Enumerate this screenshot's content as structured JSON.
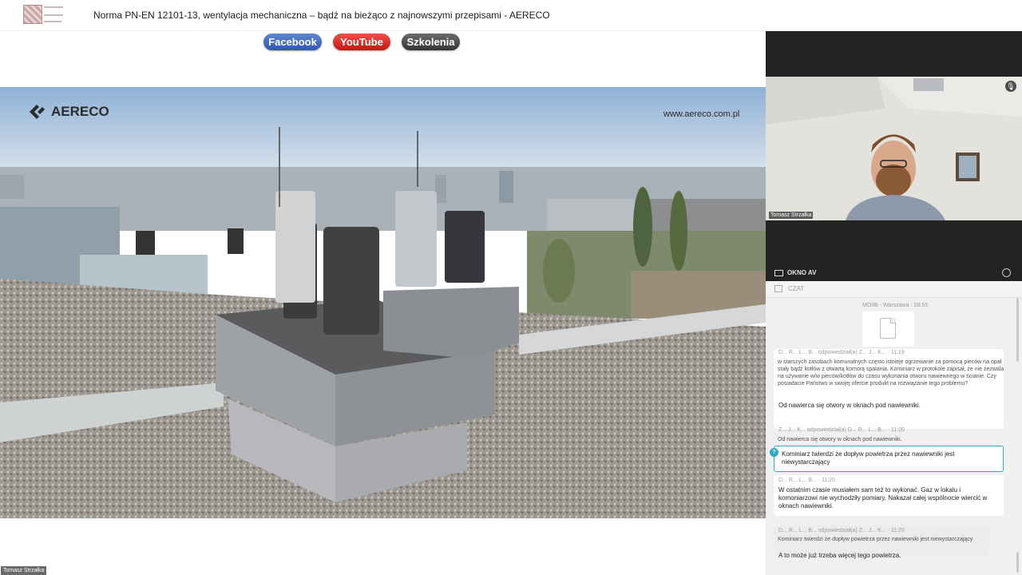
{
  "header": {
    "title": "Norma PN-EN 12101-13, wentylacja mechaniczna – bądź na bieżąco z najnowszymi przepisami - AERECO"
  },
  "social": {
    "facebook": "Facebook",
    "youtube": "YouTube",
    "szkolenia": "Szkolenia"
  },
  "slide": {
    "brand": "AERECO",
    "url": "www.aereco.com.pl"
  },
  "presenter_tag": "Tomasz Strzałka",
  "video_panel": {
    "camera_name": "Tomasz Strzałka",
    "av_label": "OKNO AV"
  },
  "chat": {
    "header": "CZAT",
    "messages": [
      {
        "meta": "MOIIB - Warszawa · 09:55",
        "type": "file"
      },
      {
        "meta": "D... R... L... B... odpowiedział(a) Z... J... K... · 11:19",
        "quote": "w starszych zasobach komunalnych często istnieje ogrzewanie za pomocą pieców na opał stały bądź kotłów z otwartą komorą spalania. Kominiarz w protokole zapisał, że nie zezwala na używanie w/w pieców/kotłów do czasu wykonania otworu nawiewnego w ścianie. Czy posiadacie Państwo w swojej ofercie produkt na rozwiązanie tego problemu?",
        "text": "Od nawierca się otwory w oknach pod nawiewniki."
      },
      {
        "meta": "Z... J... K... odpowiedział(a) D... R... L... B... · 11:20",
        "quote": "Od nawierca się otwory w oknach pod nawiewniki.",
        "text": "Kominiarz twierdzi że dopływ powietrza przez nawiewniki jest niewystarczający",
        "badge": "?"
      },
      {
        "meta": "D... R... L... B... · 11:20",
        "text": "W ostatnim czasie musiałem sam też to wykonać. Gaz w lokalu i komoniarzowi nie wychodziły pomiary. Nakazał całej wspólnocie wiercić w oknach nawiewniki."
      },
      {
        "meta": "D... R... L... B... odpowiedział(a) Z... J... K... · 11:20",
        "quote": "Kominiarz twierdzi że dopływ powietrza przez nawiewniki jest niewystarczający",
        "text": "A to może już trzeba więcej tego powietrza."
      }
    ]
  }
}
